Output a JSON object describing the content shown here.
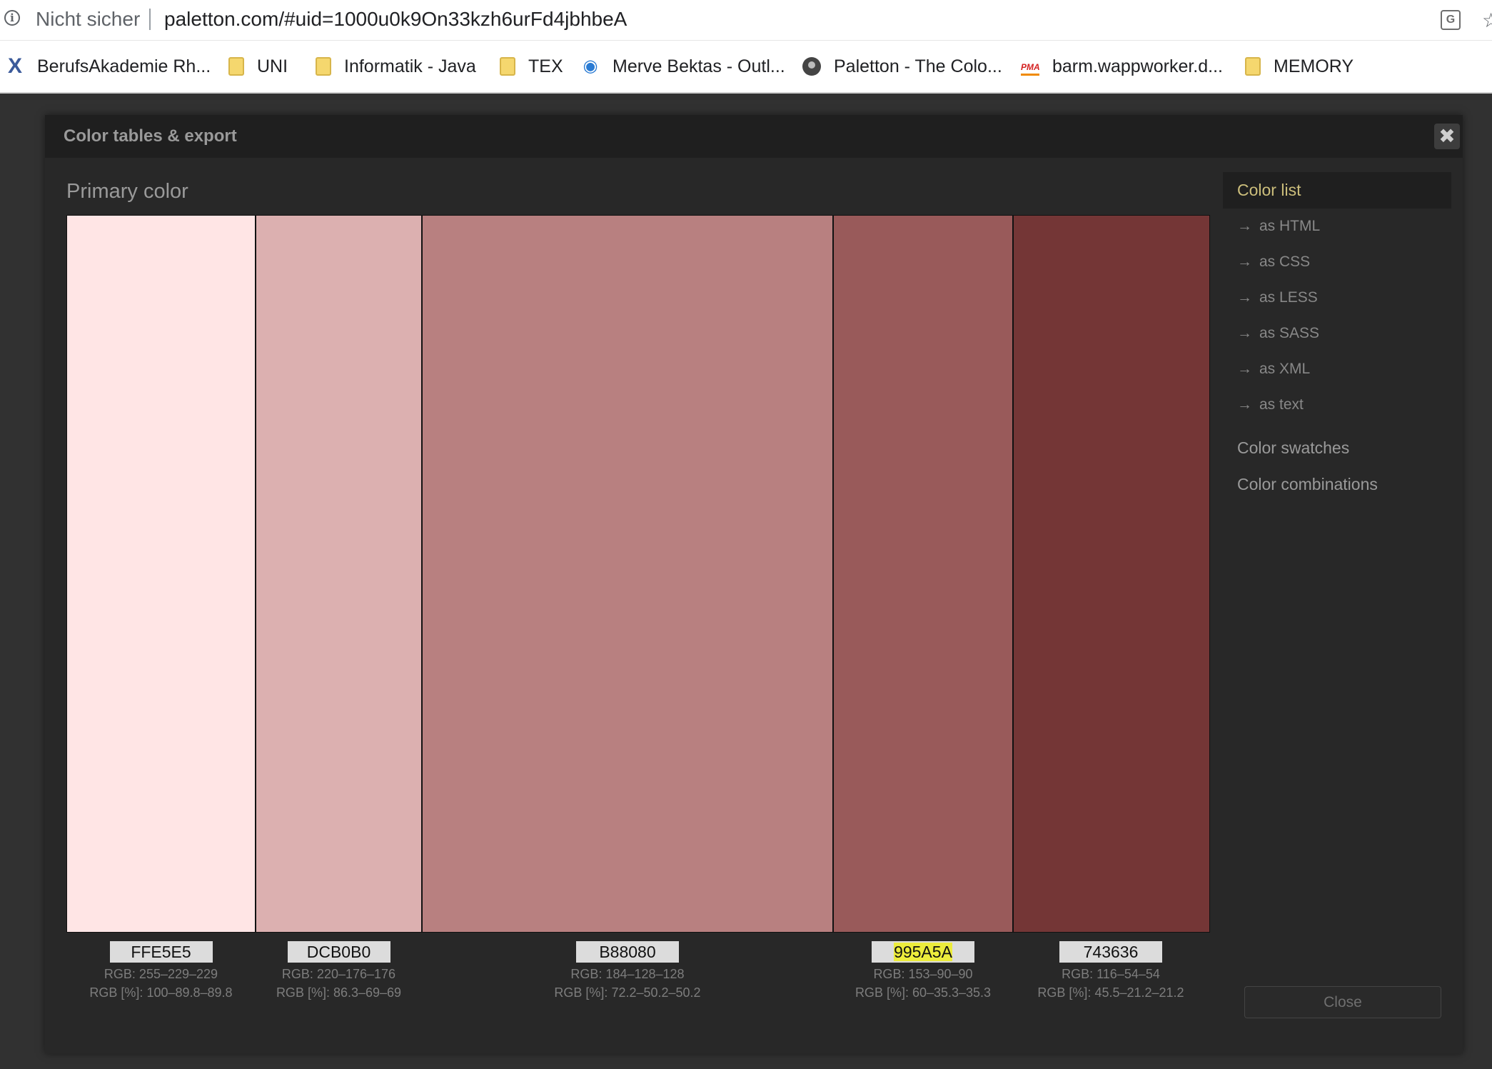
{
  "browser": {
    "not_secure": "Nicht sicher",
    "url": "paletton.com/#uid=1000u0k9On33kzh6urFd4jbhbeA",
    "bookmarks": [
      {
        "label": "BerufsAkademie Rh...",
        "icon": "x-logo-icon"
      },
      {
        "label": "UNI",
        "icon": "folder-icon"
      },
      {
        "label": "Informatik - Java",
        "icon": "folder-icon"
      },
      {
        "label": "TEX",
        "icon": "folder-icon"
      },
      {
        "label": "Merve Bektas - Outl...",
        "icon": "eye-icon"
      },
      {
        "label": "Paletton - The Colo...",
        "icon": "paletton-icon"
      },
      {
        "label": "barm.wappworker.d...",
        "icon": "pma-icon"
      },
      {
        "label": "MEMORY",
        "icon": "folder-icon"
      }
    ]
  },
  "modal": {
    "title": "Color tables & export",
    "close_icon": "close-icon",
    "section_title": "Primary color",
    "swatches": [
      {
        "hex": "FFE5E5",
        "color": "#FFE5E5",
        "rgb": "RGB: 255–229–229",
        "rgbp": "RGB [%]: 100–89.8–89.8",
        "highlight": false
      },
      {
        "hex": "DCB0B0",
        "color": "#DCB0B0",
        "rgb": "RGB: 220–176–176",
        "rgbp": "RGB [%]: 86.3–69–69",
        "highlight": false
      },
      {
        "hex": "B88080",
        "color": "#B88080",
        "rgb": "RGB: 184–128–128",
        "rgbp": "RGB [%]: 72.2–50.2–50.2",
        "highlight": false
      },
      {
        "hex": "995A5A",
        "color": "#995A5A",
        "rgb": "RGB: 153–90–90",
        "rgbp": "RGB [%]: 60–35.3–35.3",
        "highlight": true
      },
      {
        "hex": "743636",
        "color": "#743636",
        "rgb": "RGB: 116–54–54",
        "rgbp": "RGB [%]: 45.5–21.2–21.2",
        "highlight": false
      }
    ],
    "menu": {
      "active": "Color list",
      "arrow": "→",
      "sub_items": [
        "as HTML",
        "as CSS",
        "as LESS",
        "as SASS",
        "as XML",
        "as text"
      ],
      "main_items": [
        "Color swatches",
        "Color combinations"
      ]
    },
    "close_button": "Close"
  }
}
